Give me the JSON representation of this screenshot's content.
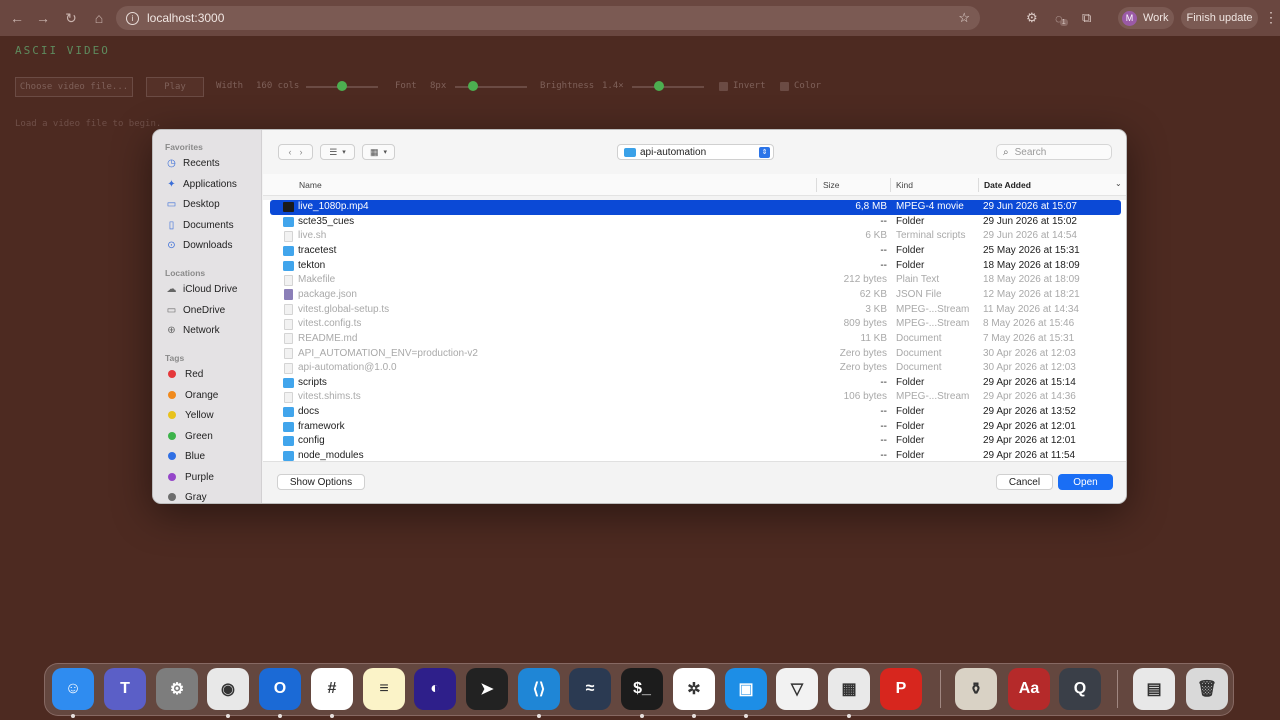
{
  "browser": {
    "url": "localhost:3000",
    "profile_initial": "M",
    "profile_label": "Work",
    "update_label": "Finish update",
    "extension_badge": "1"
  },
  "app": {
    "title": "ASCII VIDEO",
    "choose_file": "Choose video file...",
    "play": "Play",
    "width_label": "Width",
    "width_value": "160 cols",
    "font_label": "Font",
    "font_value": "8px",
    "brightness_label": "Brightness",
    "brightness_value": "1.4×",
    "invert_label": "Invert",
    "color_label": "Color",
    "load_message": "Load a video file to begin."
  },
  "dialog": {
    "sidebar": {
      "favorites_header": "Favorites",
      "favorites": [
        {
          "label": "Recents",
          "icon": "clock-icon"
        },
        {
          "label": "Applications",
          "icon": "applications-icon"
        },
        {
          "label": "Desktop",
          "icon": "desktop-icon"
        },
        {
          "label": "Documents",
          "icon": "document-icon"
        },
        {
          "label": "Downloads",
          "icon": "download-icon"
        }
      ],
      "locations_header": "Locations",
      "locations": [
        {
          "label": "iCloud Drive",
          "icon": "cloud-icon"
        },
        {
          "label": "OneDrive",
          "icon": "folder-icon"
        },
        {
          "label": "Network",
          "icon": "globe-icon"
        }
      ],
      "tags_header": "Tags",
      "tags": [
        {
          "label": "Red",
          "color": "#e5383b"
        },
        {
          "label": "Orange",
          "color": "#f08a1c"
        },
        {
          "label": "Yellow",
          "color": "#e8c21c"
        },
        {
          "label": "Green",
          "color": "#3cb34a"
        },
        {
          "label": "Blue",
          "color": "#2f6fe4"
        },
        {
          "label": "Purple",
          "color": "#9546c9"
        },
        {
          "label": "Gray",
          "color": "#6d6d6d"
        }
      ]
    },
    "location": "api-automation",
    "search_placeholder": "Search",
    "columns": {
      "name": "Name",
      "size": "Size",
      "kind": "Kind",
      "date": "Date Added"
    },
    "files": [
      {
        "name": "live_1080p.mp4",
        "size": "6,8 MB",
        "kind": "MPEG-4 movie",
        "date": "29 Jun 2026 at 15:07",
        "type": "movie",
        "selected": true,
        "dim": false
      },
      {
        "name": "scte35_cues",
        "size": "--",
        "kind": "Folder",
        "date": "29 Jun 2026 at 15:02",
        "type": "folder",
        "selected": false,
        "dim": false
      },
      {
        "name": "live.sh",
        "size": "6 KB",
        "kind": "Terminal scripts",
        "date": "29 Jun 2026 at 14:54",
        "type": "doc",
        "selected": false,
        "dim": true
      },
      {
        "name": "tracetest",
        "size": "--",
        "kind": "Folder",
        "date": "25 May 2026 at 15:31",
        "type": "folder",
        "selected": false,
        "dim": false
      },
      {
        "name": "tekton",
        "size": "--",
        "kind": "Folder",
        "date": "18 May 2026 at 18:09",
        "type": "folder",
        "selected": false,
        "dim": false
      },
      {
        "name": "Makefile",
        "size": "212 bytes",
        "kind": "Plain Text",
        "date": "18 May 2026 at 18:09",
        "type": "doc",
        "selected": false,
        "dim": true
      },
      {
        "name": "package.json",
        "size": "62 KB",
        "kind": "JSON File",
        "date": "12 May 2026 at 18:21",
        "type": "json",
        "selected": false,
        "dim": true
      },
      {
        "name": "vitest.global-setup.ts",
        "size": "3 KB",
        "kind": "MPEG-...Stream",
        "date": "11 May 2026 at 14:34",
        "type": "doc",
        "selected": false,
        "dim": true
      },
      {
        "name": "vitest.config.ts",
        "size": "809 bytes",
        "kind": "MPEG-...Stream",
        "date": "8 May 2026 at 15:46",
        "type": "doc",
        "selected": false,
        "dim": true
      },
      {
        "name": "README.md",
        "size": "11 KB",
        "kind": "Document",
        "date": "7 May 2026 at 15:31",
        "type": "doc",
        "selected": false,
        "dim": true
      },
      {
        "name": "API_AUTOMATION_ENV=production-v2",
        "size": "Zero bytes",
        "kind": "Document",
        "date": "30 Apr 2026 at 12:03",
        "type": "doc",
        "selected": false,
        "dim": true
      },
      {
        "name": "api-automation@1.0.0",
        "size": "Zero bytes",
        "kind": "Document",
        "date": "30 Apr 2026 at 12:03",
        "type": "doc",
        "selected": false,
        "dim": true
      },
      {
        "name": "scripts",
        "size": "--",
        "kind": "Folder",
        "date": "29 Apr 2026 at 15:14",
        "type": "folder",
        "selected": false,
        "dim": false
      },
      {
        "name": "vitest.shims.ts",
        "size": "106 bytes",
        "kind": "MPEG-...Stream",
        "date": "29 Apr 2026 at 14:36",
        "type": "doc",
        "selected": false,
        "dim": true
      },
      {
        "name": "docs",
        "size": "--",
        "kind": "Folder",
        "date": "29 Apr 2026 at 13:52",
        "type": "folder",
        "selected": false,
        "dim": false
      },
      {
        "name": "framework",
        "size": "--",
        "kind": "Folder",
        "date": "29 Apr 2026 at 12:01",
        "type": "folder",
        "selected": false,
        "dim": false
      },
      {
        "name": "config",
        "size": "--",
        "kind": "Folder",
        "date": "29 Apr 2026 at 12:01",
        "type": "folder",
        "selected": false,
        "dim": false
      },
      {
        "name": "node_modules",
        "size": "--",
        "kind": "Folder",
        "date": "29 Apr 2026 at 11:54",
        "type": "folder",
        "selected": false,
        "dim": false
      }
    ],
    "show_options": "Show Options",
    "cancel": "Cancel",
    "open": "Open"
  },
  "dock": {
    "apps": [
      {
        "name": "finder",
        "icon": "finder-icon",
        "color": "#2f8cf0",
        "glyph": "☺"
      },
      {
        "name": "teams",
        "icon": "teams-icon",
        "color": "#5b5fc7",
        "glyph": "T"
      },
      {
        "name": "system-settings",
        "icon": "gear-icon",
        "color": "#7d7d7d",
        "glyph": "⚙"
      },
      {
        "name": "chrome",
        "icon": "chrome-icon",
        "color": "#e8e8e8",
        "glyph": "◉"
      },
      {
        "name": "outlook",
        "icon": "outlook-icon",
        "color": "#1b6ad6",
        "glyph": "O"
      },
      {
        "name": "slack",
        "icon": "slack-icon",
        "color": "#ffffff",
        "glyph": "#"
      },
      {
        "name": "notes",
        "icon": "notes-icon",
        "color": "#fbf3c8",
        "glyph": "≡"
      },
      {
        "name": "app-purple",
        "icon": "circle-app-icon",
        "color": "#2e1f8a",
        "glyph": "◐"
      },
      {
        "name": "app-dark",
        "icon": "arrow-app-icon",
        "color": "#222222",
        "glyph": "➤"
      },
      {
        "name": "vscode",
        "icon": "vscode-icon",
        "color": "#1f86d6",
        "glyph": "⟨⟩"
      },
      {
        "name": "mysql-workbench",
        "icon": "dolphin-icon",
        "color": "#2b3a52",
        "glyph": "≈"
      },
      {
        "name": "terminal",
        "icon": "terminal-icon",
        "color": "#1c1c1c",
        "glyph": "$_"
      },
      {
        "name": "chatgpt",
        "icon": "chatgpt-icon",
        "color": "#ffffff",
        "glyph": "✲"
      },
      {
        "name": "docker",
        "icon": "docker-icon",
        "color": "#1d8ee6",
        "glyph": "▣"
      },
      {
        "name": "proton-vpn",
        "icon": "vpn-icon",
        "color": "#f2f2f2",
        "glyph": "▽"
      },
      {
        "name": "launchpad",
        "icon": "grid-icon",
        "color": "#e9e9e9",
        "glyph": "▦"
      },
      {
        "name": "acrobat",
        "icon": "pdf-icon",
        "color": "#d7261e",
        "glyph": "P"
      },
      {
        "name": "script-app",
        "icon": "jar-icon",
        "color": "#d9d2c5",
        "glyph": "⚱"
      },
      {
        "name": "dictionary",
        "icon": "dictionary-icon",
        "color": "#b52a2a",
        "glyph": "Aa"
      },
      {
        "name": "quicktime",
        "icon": "quicktime-icon",
        "color": "#3a3f48",
        "glyph": "Q"
      },
      {
        "name": "minimized-window",
        "icon": "window-thumbnail-icon",
        "color": "#e8e8e8",
        "glyph": "▤"
      },
      {
        "name": "trash",
        "icon": "trash-icon",
        "color": "#d9d9d9",
        "glyph": "🗑"
      }
    ]
  }
}
